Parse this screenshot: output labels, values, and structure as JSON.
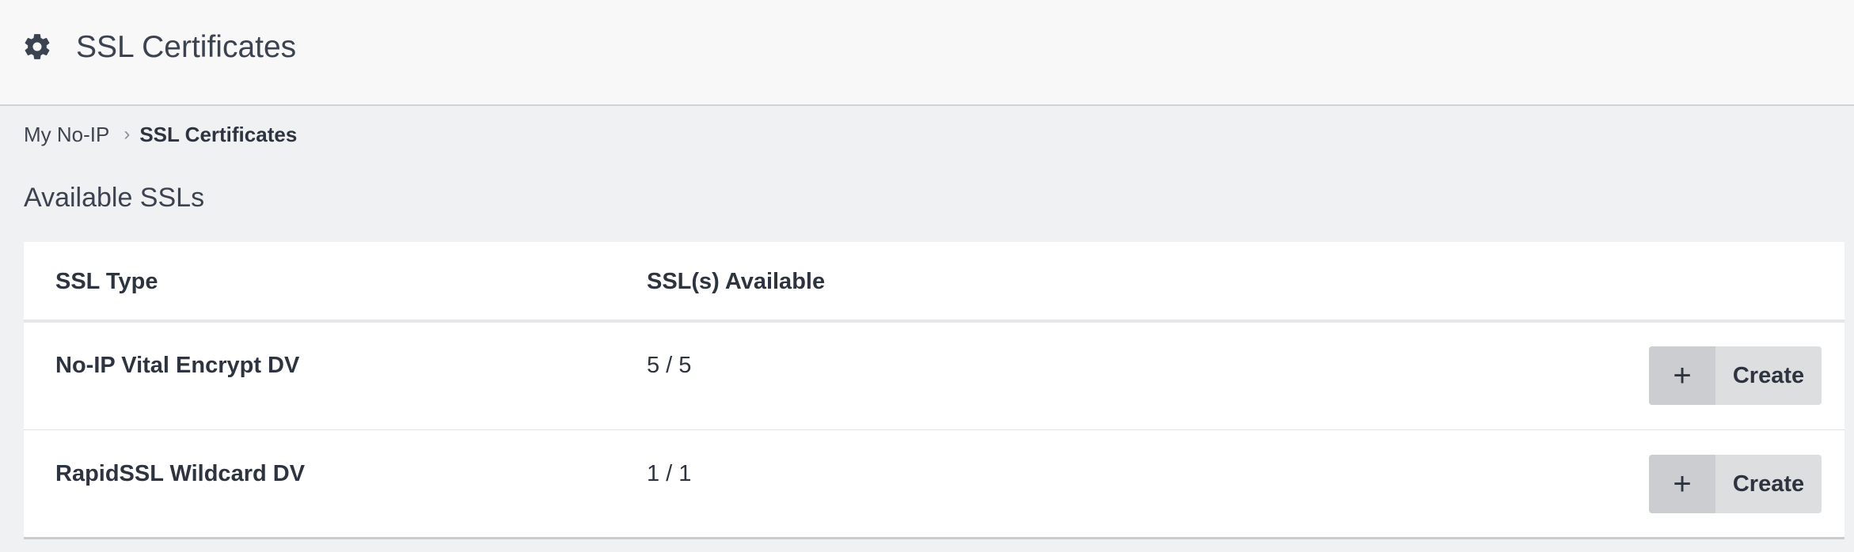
{
  "header": {
    "title": "SSL Certificates",
    "icon": "gear-icon"
  },
  "breadcrumb": {
    "items": [
      {
        "label": "My No-IP"
      },
      {
        "label": "SSL Certificates"
      }
    ],
    "separator": "›"
  },
  "section": {
    "title": "Available SSLs"
  },
  "table": {
    "columns": [
      "SSL Type",
      "SSL(s) Available"
    ],
    "rows": [
      {
        "type": "No-IP Vital Encrypt DV",
        "available": "5 / 5",
        "action_icon": "+",
        "action_label": "Create"
      },
      {
        "type": "RapidSSL Wildcard DV",
        "available": "1 / 1",
        "action_icon": "+",
        "action_label": "Create"
      }
    ]
  },
  "colors": {
    "header_bg": "#f8f8f8",
    "page_bg": "#f0f1f3",
    "text": "#2d3440",
    "button_bg": "#dddee0",
    "button_icon_bg": "#cbcdd0"
  }
}
